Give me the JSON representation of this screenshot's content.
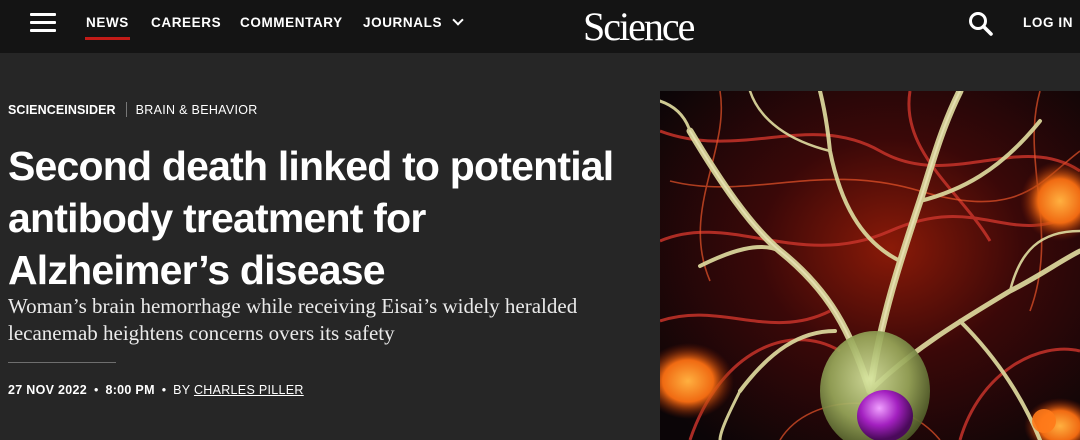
{
  "nav": {
    "items": [
      {
        "label": "NEWS",
        "active": true
      },
      {
        "label": "CAREERS"
      },
      {
        "label": "COMMENTARY"
      },
      {
        "label": "JOURNALS"
      }
    ],
    "logo": "Science",
    "login": "LOG IN",
    "icons": [
      "menu-icon",
      "chevron-down-icon",
      "search-icon"
    ]
  },
  "article": {
    "section": "SCIENCEINSIDER",
    "topic": "BRAIN & BEHAVIOR",
    "headline": "Second death linked to potential antibody treatment for Alzheimer’s disease",
    "subhead": "Woman’s brain hemorrhage while receiving Eisai’s widely heralded lecanemab heightens concerns overs its safety",
    "date": "27 NOV 2022",
    "time": "8:00 PM",
    "by": "BY",
    "author": "CHARLES PILLER"
  },
  "colors": {
    "accent": "#c21b17",
    "page_bg": "#262626",
    "topbar_bg": "#141414"
  }
}
